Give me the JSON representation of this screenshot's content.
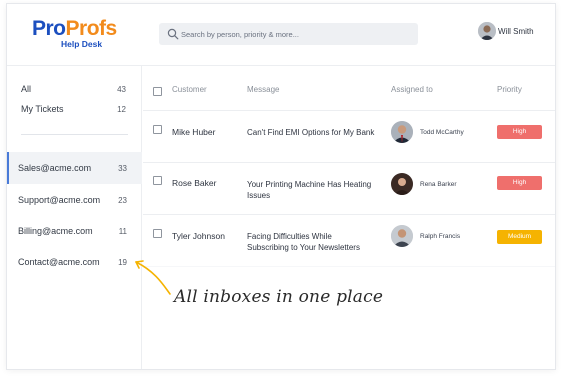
{
  "brand": {
    "logo_pro": "Pro",
    "logo_profs": "Profs",
    "logo_sub": "Help Desk",
    "colors": {
      "pro": "#1c4fbf",
      "profs": "#f28b1c"
    }
  },
  "search": {
    "placeholder": "Search by person, priority & more...",
    "icon": "search-icon"
  },
  "user": {
    "name": "Will Smith"
  },
  "sidebar": {
    "views": [
      {
        "label": "All",
        "count": "43"
      },
      {
        "label": "My Tickets",
        "count": "12"
      }
    ],
    "inboxes": [
      {
        "label": "Sales@acme.com",
        "count": "33",
        "active": true
      },
      {
        "label": "Support@acme.com",
        "count": "23"
      },
      {
        "label": "Billing@acme.com",
        "count": "11"
      },
      {
        "label": "Contact@acme.com",
        "count": "19"
      }
    ]
  },
  "table": {
    "columns": [
      "Customer",
      "Message",
      "Assigned to",
      "Priority"
    ],
    "rows": [
      {
        "customer": "Mike Huber",
        "message": "Can't Find EMI Options for My Bank",
        "assigned": "Todd McCarthy",
        "priority": "High",
        "priority_color": "#ef6f6c"
      },
      {
        "customer": "Rose Baker",
        "message": "Your Printing Machine Has Heating Issues",
        "assigned": "Rena Barker",
        "priority": "High",
        "priority_color": "#ef6f6c"
      },
      {
        "customer": "Tyler Johnson",
        "message": "Facing Difficulties While Subscribing to Your Newsletters",
        "assigned": "Ralph Francis",
        "priority": "Medium",
        "priority_color": "#f5b301"
      }
    ]
  },
  "annotation": {
    "text": "All inboxes in one place"
  }
}
